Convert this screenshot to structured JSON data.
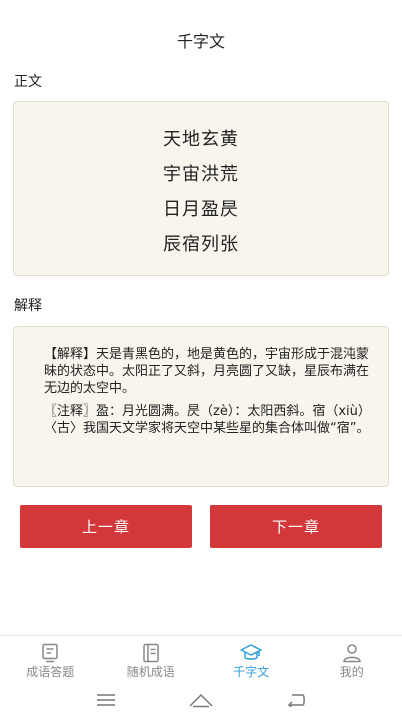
{
  "header": {
    "title": "千字文"
  },
  "main_text": {
    "label": "正文",
    "verses": [
      "天地玄黄",
      "宇宙洪荒",
      "日月盈昃",
      "辰宿列张"
    ]
  },
  "explanation": {
    "label": "解释",
    "paragraph1": "【解释】天是青黑色的，地是黄色的，宇宙形成于混沌蒙昧的状态中。太阳正了又斜，月亮圆了又缺，星辰布满在无边的太空中。",
    "paragraph2": "〖注释〗盈：月光圆满。昃（zè）：太阳西斜。宿（xiù）〈古〉我国天文学家将天空中某些星的集合体叫做“宿”。"
  },
  "buttons": {
    "prev": "上一章",
    "next": "下一章"
  },
  "tabs": [
    {
      "label": "成语答题",
      "icon": "quiz-icon"
    },
    {
      "label": "随机成语",
      "icon": "random-idiom-icon"
    },
    {
      "label": "千字文",
      "icon": "graduation-cap-icon"
    },
    {
      "label": "我的",
      "icon": "user-icon"
    }
  ],
  "active_tab": "千字文",
  "colors": {
    "accent_button": "#d2373a",
    "active_tab": "#2f9fd8",
    "card_bg": "#f8f5ec"
  },
  "system_nav": [
    "menu-icon",
    "home-icon",
    "back-icon"
  ]
}
